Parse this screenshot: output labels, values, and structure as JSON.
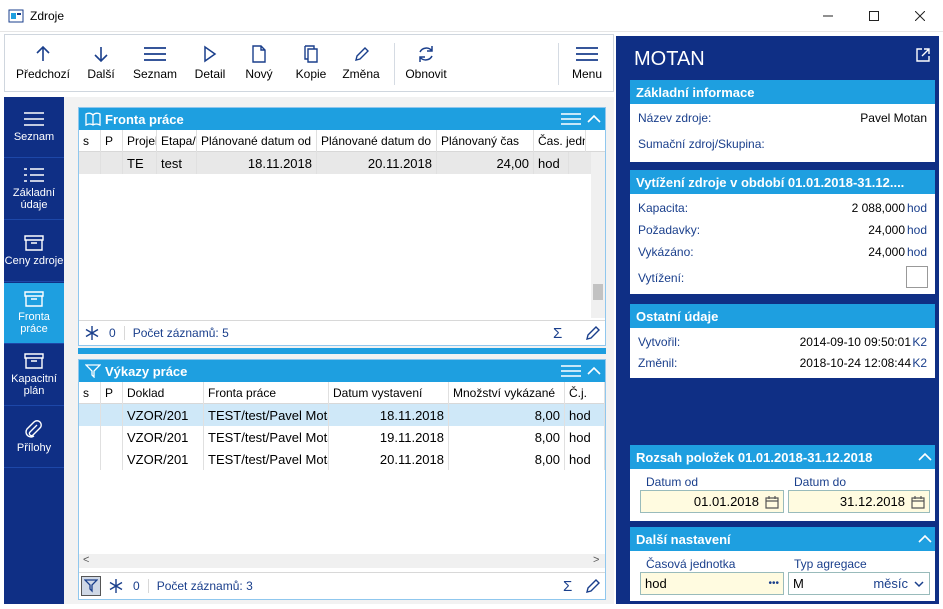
{
  "window": {
    "title": "Zdroje"
  },
  "toolbar": {
    "items": [
      {
        "label": "Předchozí",
        "icon": "arrow-up-icon"
      },
      {
        "label": "Další",
        "icon": "arrow-down-icon"
      },
      {
        "label": "Seznam",
        "icon": "list-icon"
      },
      {
        "label": "Detail",
        "icon": "play-icon"
      },
      {
        "label": "Nový",
        "icon": "new-document-icon"
      },
      {
        "label": "Kopie",
        "icon": "copy-icon"
      },
      {
        "label": "Změna",
        "icon": "pencil-icon"
      },
      {
        "label": "Obnovit",
        "icon": "refresh-icon"
      },
      {
        "label": "Menu",
        "icon": "hamburger-icon"
      }
    ]
  },
  "leftnav": {
    "items": [
      {
        "label": "Seznam",
        "icon": "list-icon"
      },
      {
        "label": "Základní údaje",
        "icon": "details-list-icon"
      },
      {
        "label": "Ceny zdroje",
        "icon": "box-icon"
      },
      {
        "label": "Fronta práce",
        "icon": "box-icon"
      },
      {
        "label": "Kapacitní plán",
        "icon": "box-icon"
      },
      {
        "label": "Přílohy",
        "icon": "paperclip-icon"
      }
    ]
  },
  "fronta": {
    "title": "Fronta práce",
    "columns": [
      "s",
      "P",
      "Projek",
      "Etapa/",
      "Plánované datum od",
      "Plánované datum do",
      "Plánovaný čas",
      "Čas. jedn"
    ],
    "rows": [
      [
        "",
        "",
        "TE",
        "test",
        "18.11.2018",
        "20.11.2018",
        "24,00",
        "hod"
      ]
    ],
    "count_label": "Počet záznamů: 5",
    "filter_count": "0"
  },
  "vykazy": {
    "title": "Výkazy práce",
    "columns": [
      "s",
      "P",
      "Doklad",
      "Fronta práce",
      "Datum vystavení",
      "Množství vykázané",
      "Č.j."
    ],
    "rows": [
      [
        "",
        "",
        "VZOR/201",
        "TEST/test/Pavel Motan",
        "18.11.2018",
        "8,00",
        "hod"
      ],
      [
        "",
        "",
        "VZOR/201",
        "TEST/test/Pavel Motan",
        "19.11.2018",
        "8,00",
        "hod"
      ],
      [
        "",
        "",
        "VZOR/201",
        "TEST/test/Pavel Motan",
        "20.11.2018",
        "8,00",
        "hod"
      ]
    ],
    "count_label": "Počet záznamů: 3",
    "filter_count": "0"
  },
  "right": {
    "title": "MOTAN",
    "basic": {
      "header": "Základní informace",
      "name_label": "Název zdroje:",
      "name_value": "Pavel Motan",
      "group_label": "Sumační zdroj/Skupina:"
    },
    "usage": {
      "header": "Vytížení zdroje v období 01.01.2018-31.12....",
      "capacity_label": "Kapacita:",
      "capacity_value": "2 088,000",
      "capacity_unit": "hod",
      "demand_label": "Požadavky:",
      "demand_value": "24,000",
      "demand_unit": "hod",
      "reported_label": "Vykázáno:",
      "reported_value": "24,000",
      "reported_unit": "hod",
      "util_label": "Vytížení:"
    },
    "other": {
      "header": "Ostatní údaje",
      "created_label": "Vytvořil:",
      "created_value": "2014-09-10 09:50:01",
      "created_user": "K2",
      "changed_label": "Změnil:",
      "changed_value": "2018-10-24 12:08:44",
      "changed_user": "K2"
    },
    "range": {
      "header": "Rozsah položek 01.01.2018-31.12.2018",
      "from_label": "Datum od",
      "from_value": "01.01.2018",
      "to_label": "Datum do",
      "to_value": "31.12.2018"
    },
    "settings": {
      "header": "Další nastavení",
      "unit_label": "Časová jednotka",
      "unit_value": "hod",
      "agg_label": "Typ agregace",
      "agg_value": "M",
      "agg_text": "měsíc"
    }
  },
  "colors": {
    "accent": "#1e9fe0",
    "nav": "#0f2f85",
    "input": "#fffbe0"
  }
}
